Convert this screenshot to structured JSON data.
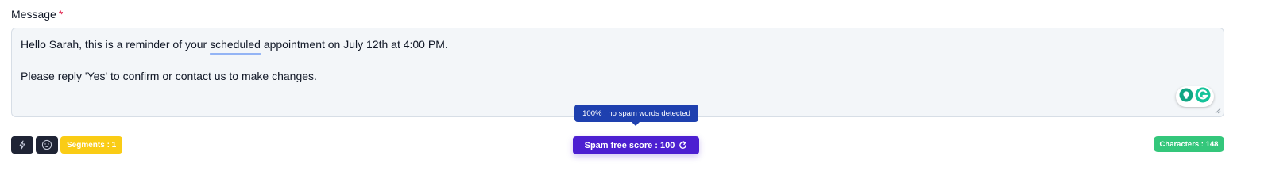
{
  "field": {
    "label": "Message",
    "required_mark": "*"
  },
  "message": {
    "line1_before": "Hello Sarah, this is a reminder of your ",
    "line1_flagged": "scheduled",
    "line1_after": " appointment on July 12th at 4:00 PM.",
    "line2": "",
    "line3": "Please reply 'Yes' to confirm or contact us to make changes."
  },
  "toolbar": {
    "lightning_icon": "lightning-icon",
    "emoji_icon": "smiley-icon",
    "segments_label": "Segments : 1"
  },
  "spam": {
    "tooltip": "100% : no spam words detected",
    "button_label": "Spam free score : 100",
    "refresh_icon": "refresh-icon"
  },
  "characters_label": "Characters : 148",
  "colors": {
    "segments_badge": "#facc15",
    "spam_button": "#4c1fd1",
    "tooltip": "#1e40af",
    "characters_badge": "#34c77b",
    "icon_buttons": "#1f2435",
    "required": "#e11d48"
  }
}
